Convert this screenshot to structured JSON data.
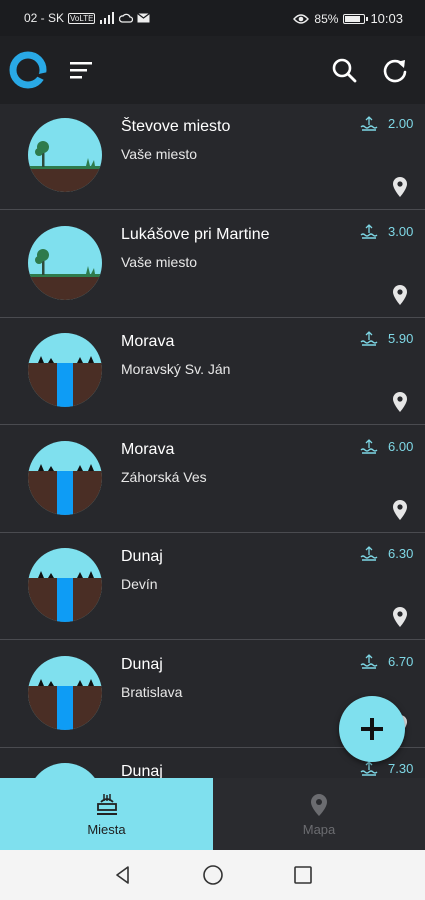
{
  "status_bar": {
    "carrier": "02 - SK",
    "network": "VoLTE",
    "battery": "85%",
    "battery_level": 0.85,
    "time": "10:03"
  },
  "toolbar": {
    "icons": [
      "app-logo",
      "menu-icon",
      "search-icon",
      "refresh-icon"
    ]
  },
  "places": [
    {
      "title": "Števove miesto",
      "subtitle": "Vaše miesto",
      "level": "2.00",
      "image": "tree-landscape"
    },
    {
      "title": "Lukášove pri Martine",
      "subtitle": "Vaše miesto",
      "level": "3.00",
      "image": "tree-landscape"
    },
    {
      "title": "Morava",
      "subtitle": "Moravský Sv. Ján",
      "level": "5.90",
      "image": "river-cross-section"
    },
    {
      "title": "Morava",
      "subtitle": "Záhorská Ves",
      "level": "6.00",
      "image": "river-cross-section"
    },
    {
      "title": "Dunaj",
      "subtitle": "Devín",
      "level": "6.30",
      "image": "river-cross-section"
    },
    {
      "title": "Dunaj",
      "subtitle": "Bratislava",
      "level": "6.70",
      "image": "river-cross-section"
    },
    {
      "title": "Dunaj",
      "subtitle": "",
      "level": "7.30",
      "image": "river-cross-section"
    }
  ],
  "fab": {
    "icon": "plus-icon"
  },
  "bottom_nav": {
    "miesta": "Miesta",
    "mapa": "Mapa",
    "active": "miesta"
  },
  "colors": {
    "accent": "#7fe0ee",
    "background": "#27282c",
    "level_text": "#7fd8e6"
  }
}
